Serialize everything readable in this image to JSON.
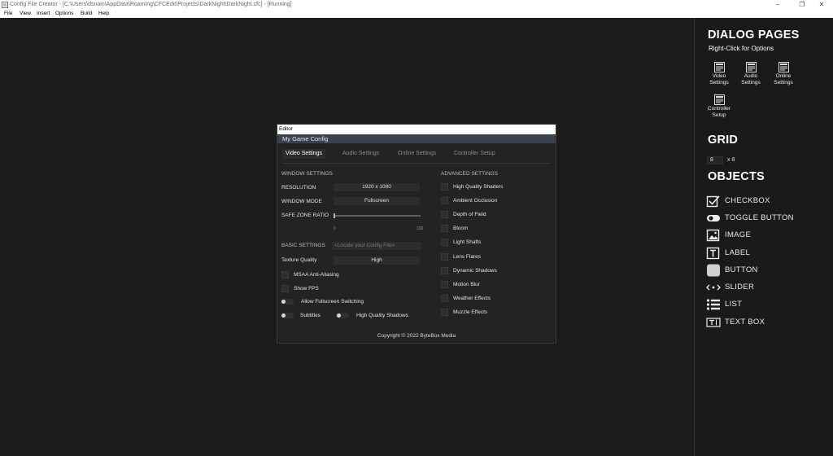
{
  "window": {
    "title": "Config File Creator - [C:\\Users\\dsnain\\AppData\\Roaming\\CFCEdit\\Projects\\DarkNight\\DarkNight.cfc] - [Running]",
    "controls": [
      "–",
      "❐",
      "✕"
    ]
  },
  "menu": [
    "File",
    "View",
    "Insert",
    "Options",
    "Build",
    "Help"
  ],
  "sidebar": {
    "dialog_pages_title": "DIALOG PAGES",
    "dialog_pages_hint": "Right-Click for Options",
    "pages": [
      {
        "line1": "Video",
        "line2": "Settings",
        "icon": "page-icon"
      },
      {
        "line1": "Audio",
        "line2": "Settings",
        "icon": "page-icon"
      },
      {
        "line1": "Online",
        "line2": "Settings",
        "icon": "page-icon"
      },
      {
        "line1": "Controller",
        "line2": "Setup",
        "icon": "page-icon"
      }
    ],
    "grid_title": "GRID",
    "grid_w": "8",
    "grid_sep": "x 8",
    "objects_title": "OBJECTS",
    "objects": [
      {
        "label": "CHECKBOX",
        "icon": "checkbox-icon"
      },
      {
        "label": "TOGGLE BUTTON",
        "icon": "toggle-icon"
      },
      {
        "label": "IMAGE",
        "icon": "image-icon"
      },
      {
        "label": "LABEL",
        "icon": "label-icon"
      },
      {
        "label": "BUTTON",
        "icon": "button-icon"
      },
      {
        "label": "SLIDER",
        "icon": "slider-icon"
      },
      {
        "label": "LIST",
        "icon": "list-icon"
      },
      {
        "label": "TEXT BOX",
        "icon": "textbox-icon"
      }
    ]
  },
  "editor": {
    "title": "Editor",
    "config_name": "My Game Config",
    "tabs": [
      "Video Settings",
      "Audio Settings",
      "Online Settings",
      "Controller Setup"
    ],
    "active_tab": "Video Settings",
    "window_settings": {
      "title": "WINDOW SETTINGS",
      "resolution_label": "RESOLUTION",
      "resolution_value": "1920 x 1080",
      "window_mode_label": "WINDOW MODE",
      "window_mode_value": "Fullscreen",
      "safe_zone_label": "SAFE ZONE RATIO",
      "safe_zone_min": "0",
      "safe_zone_max": "100",
      "safe_zone_level": 0
    },
    "basic_settings": {
      "title": "BASIC SETTINGS",
      "config_file_placeholder": "<Locate your Config File>",
      "texture_label": "Texture Quality",
      "texture_value": "High",
      "msaa_label": "MSAA Anti-Aliasing",
      "show_fps_label": "Show FPS",
      "fullscreen_switch_label": "Allow Fullscreen Switching",
      "subtitles_label": "Subtitles",
      "hq_shadows_label": "High Quality Shadows"
    },
    "advanced_settings": {
      "title": "ADVANCED SETTINGS",
      "items": [
        "High Quality Shaders",
        "Ambient Occlusion",
        "Depth of Field",
        "Bloom",
        "Light Shafts",
        "Lens Flares",
        "Dynamic Shadows",
        "Motion Blur",
        "Weather Effects",
        "Muzzle Effects"
      ]
    },
    "copyright": "Copyright © 2022 ByteBox Media"
  },
  "colors": {
    "background": "#1c1c1c",
    "sidebar": "#1a1a1a",
    "editor": "#232325",
    "accent_bar": "#3a4250"
  }
}
